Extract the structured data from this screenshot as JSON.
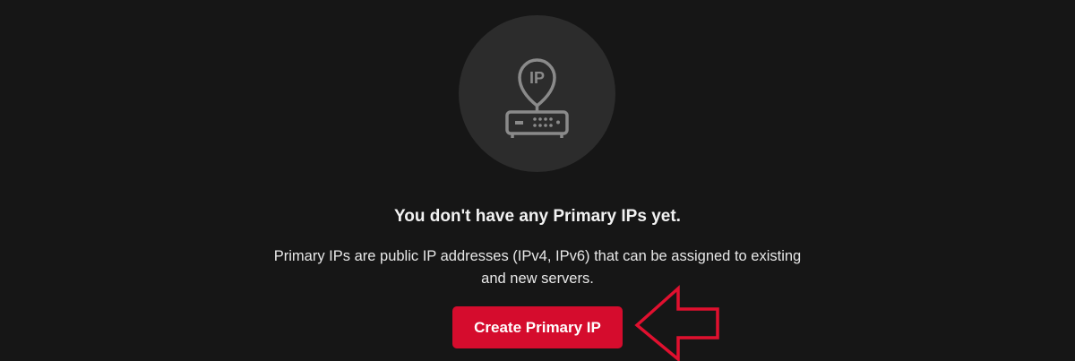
{
  "empty_state": {
    "illustration": {
      "icon": "ip-router-icon",
      "badge_text": "IP"
    },
    "title": "You don't have any Primary IPs yet.",
    "description_line1": "Primary IPs are public IP addresses (IPv4, IPv6) that can be assigned to existing",
    "description_line2": "and new servers.",
    "create_button_label": "Create Primary IP"
  },
  "colors": {
    "background": "#161616",
    "illustration_circle": "#2c2c2c",
    "icon_stroke": "#8a8a8a",
    "button_primary": "#d50c2d",
    "annotation_arrow": "#e0102f"
  }
}
